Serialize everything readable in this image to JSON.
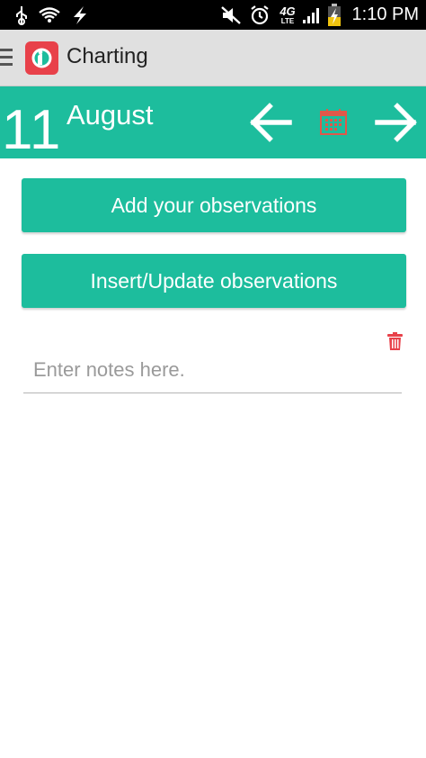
{
  "status_bar": {
    "time": "1:10 PM",
    "icons": [
      "usb-icon",
      "wifi-icon",
      "flash-icon",
      "mute-icon",
      "alarm-icon",
      "4g-lte-icon",
      "signal-icon",
      "battery-charging-icon"
    ],
    "network_label": "4G",
    "network_sub": "LTE"
  },
  "action_bar": {
    "title": "Charting",
    "icons": [
      "drawer-menu-icon",
      "app-logo-icon"
    ]
  },
  "date_header": {
    "day": "11",
    "month": "August",
    "icons": [
      "arrow-left-icon",
      "calendar-icon",
      "arrow-right-icon"
    ]
  },
  "buttons": {
    "add_observations": "Add your observations",
    "insert_update_observations": "Insert/Update observations"
  },
  "notes": {
    "placeholder": "Enter notes here.",
    "value": ""
  },
  "colors": {
    "accent": "#1dbd9d",
    "action_bar": "#e0e0e0",
    "status_bar": "#000000",
    "danger": "#e8414a",
    "calendar_icon": "#e0584a"
  }
}
